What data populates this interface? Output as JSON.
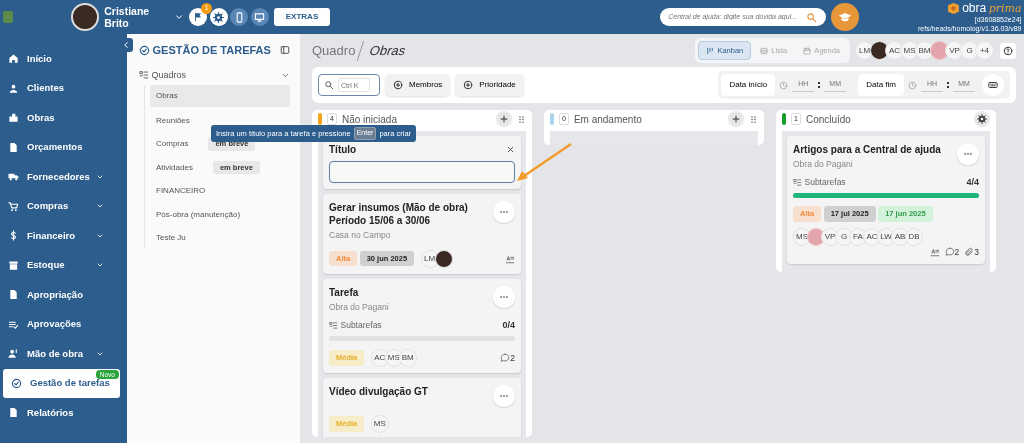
{
  "topbar": {
    "user": {
      "name": "Cristiane Brito"
    },
    "notifications_badge": "1",
    "extras_button": "EXTRAS",
    "help_search": {
      "placeholder": "Central de ajuda: digite sua dúvida aqui..."
    },
    "logo": {
      "word": "obra",
      "script_word": "prima",
      "version": "[d3608852e24]",
      "branch": "refs/heads/homolog/v1.36.03/v89"
    }
  },
  "sidebar": {
    "items": [
      {
        "label": "Início",
        "expandable": false,
        "selected": false
      },
      {
        "label": "Clientes",
        "expandable": false,
        "selected": false
      },
      {
        "label": "Obras",
        "expandable": false,
        "selected": false
      },
      {
        "label": "Orçamentos",
        "expandable": false,
        "selected": false
      },
      {
        "label": "Fornecedores",
        "expandable": true,
        "selected": false
      },
      {
        "label": "Compras",
        "expandable": true,
        "selected": false
      },
      {
        "label": "Financeiro",
        "expandable": true,
        "selected": false
      },
      {
        "label": "Estoque",
        "expandable": true,
        "selected": false
      },
      {
        "label": "Apropriação",
        "expandable": false,
        "selected": false
      },
      {
        "label": "Aprovações",
        "expandable": false,
        "selected": false
      },
      {
        "label": "Mão de obra",
        "expandable": true,
        "selected": false
      },
      {
        "label": "Gestão de tarefas",
        "expandable": false,
        "selected": true,
        "badge": "Novo"
      },
      {
        "label": "Relatórios",
        "expandable": false,
        "selected": false
      }
    ]
  },
  "panel": {
    "title": "GESTÃO DE TAREFAS",
    "tree": {
      "label": "Quadros",
      "expanded": true,
      "children": [
        {
          "label": "Obras",
          "selected": true
        },
        {
          "label": "Reuniões",
          "selected": false
        },
        {
          "label": "Compras",
          "selected": false,
          "badge": "em breve"
        },
        {
          "label": "Atividades",
          "selected": false,
          "badge": "em breve"
        },
        {
          "label": "FINANCEIRO",
          "selected": false
        },
        {
          "label": "Pós-obra (manutenção)",
          "selected": false
        },
        {
          "label": "Teste Ju",
          "selected": false
        }
      ]
    }
  },
  "breadcrumb": [
    "Quadro",
    "Obras"
  ],
  "views": [
    {
      "label": "Kanban",
      "selected": true
    },
    {
      "label": "Lista",
      "selected": false
    },
    {
      "label": "Agenda",
      "selected": false
    }
  ],
  "members": [
    {
      "kind": "initials",
      "text": "LM"
    },
    {
      "kind": "photo"
    },
    {
      "kind": "initials",
      "text": "AC"
    },
    {
      "kind": "initials",
      "text": "MS"
    },
    {
      "kind": "initials",
      "text": "BM"
    },
    {
      "kind": "blurred"
    },
    {
      "kind": "initials",
      "text": "VP"
    },
    {
      "kind": "initials",
      "text": "G"
    },
    {
      "kind": "initials",
      "text": "+4"
    }
  ],
  "filters": {
    "search": {
      "placeholder": "Ctrl K"
    },
    "buttons": [
      "Membros",
      "Prioridade"
    ],
    "ranges": [
      {
        "label": "Data início",
        "hour": {
          "placeholder": "HH"
        },
        "minute": {
          "placeholder": "MM"
        }
      },
      {
        "label": "Data fim",
        "hour": {
          "placeholder": "HH"
        },
        "minute": {
          "placeholder": "MM"
        }
      }
    ]
  },
  "tooltip": {
    "before": "Insira um título para a tarefa e pressione",
    "key": "Enter",
    "after": "para criar"
  },
  "columns": [
    {
      "count": "4",
      "title": "Não iniciada",
      "color": "#f5a31a",
      "kind": "add",
      "new_card": {
        "label": "Título"
      },
      "cards": [
        {
          "title": "Gerar insumos (Mão de obra) Período 15/06 a 30/06",
          "project": "Casa no Campo",
          "priority": {
            "label": "Alta",
            "kind": "high"
          },
          "dates": [
            {
              "text": "30 jun 2025",
              "kind": "due"
            }
          ],
          "members": [
            {
              "kind": "initials",
              "text": "LM"
            },
            {
              "kind": "photo"
            }
          ],
          "description": true
        },
        {
          "title": "Tarefa",
          "project": "Obra do Pagani",
          "subtasks": {
            "label": "Subtarefas",
            "count": "0/4",
            "level": 0
          },
          "priority": {
            "label": "Média",
            "kind": "medium"
          },
          "members": [
            {
              "kind": "initials",
              "text": "AC"
            },
            {
              "kind": "initials",
              "text": "MS"
            },
            {
              "kind": "initials",
              "text": "BM"
            }
          ],
          "comments": "2"
        },
        {
          "title": "Vídeo divulgação GT",
          "priority": {
            "label": "Média",
            "kind": "medium"
          },
          "members": [
            {
              "kind": "initials",
              "text": "MS"
            }
          ]
        }
      ]
    },
    {
      "count": "0",
      "title": "Em andamento",
      "color": "#a9d3ee",
      "kind": "add"
    },
    {
      "count": "1",
      "title": "Concluído",
      "color": "#1a9c2b",
      "kind": "settings",
      "cards": [
        {
          "title": "Artigos para a Central de ajuda",
          "project": "Obra do Pagani",
          "subtasks": {
            "label": "Subtarefas",
            "count": "4/4",
            "level": 1
          },
          "priority": {
            "label": "Alta",
            "kind": "high"
          },
          "dates": [
            {
              "text": "17 jul 2025",
              "kind": "due"
            },
            {
              "text": "17 jun 2025",
              "kind": "done"
            }
          ],
          "members": [
            {
              "kind": "initials",
              "text": "MS"
            },
            {
              "kind": "blurred"
            },
            {
              "kind": "initials",
              "text": "VP"
            },
            {
              "kind": "initials",
              "text": "G"
            },
            {
              "kind": "initials",
              "text": "FA"
            },
            {
              "kind": "initials",
              "text": "AC"
            },
            {
              "kind": "initials",
              "text": "LW"
            },
            {
              "kind": "initials",
              "text": "AB"
            },
            {
              "kind": "initials",
              "text": "DB"
            }
          ],
          "description": true,
          "comments": "2",
          "attachments": "3"
        }
      ]
    }
  ]
}
